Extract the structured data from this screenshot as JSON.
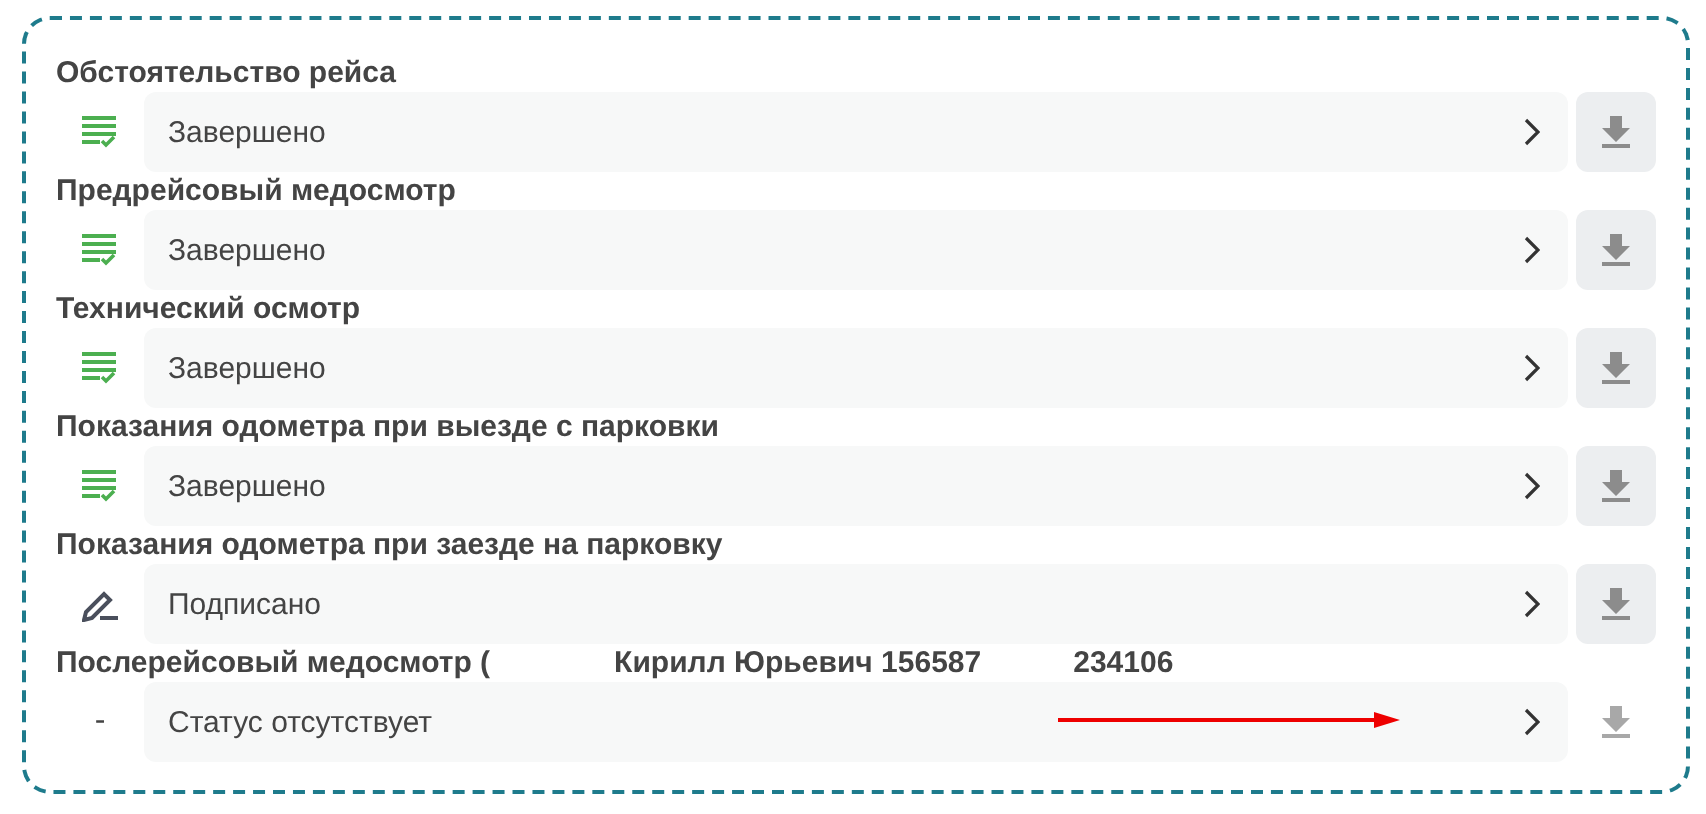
{
  "rows": [
    {
      "title_parts": [
        "Обстоятельство рейса"
      ],
      "kind": "done",
      "status": "Завершено",
      "download_enabled": true
    },
    {
      "title_parts": [
        "Предрейсовый медосмотр"
      ],
      "kind": "done",
      "status": "Завершено",
      "download_enabled": true
    },
    {
      "title_parts": [
        "Технический осмотр"
      ],
      "kind": "done",
      "status": "Завершено",
      "download_enabled": true
    },
    {
      "title_parts": [
        "Показания одометра при выезде с парковки"
      ],
      "kind": "done",
      "status": "Завершено",
      "download_enabled": true
    },
    {
      "title_parts": [
        "Показания одометра при заезде на парковку"
      ],
      "kind": "signed",
      "status": "Подписано",
      "download_enabled": true
    },
    {
      "title_parts": [
        "Послерейсовый медосмотр (",
        "Кирилл Юрьевич 156587",
        "234106"
      ],
      "kind": "none",
      "icon_text": "-",
      "status": "Статус отсутствует",
      "download_enabled": false,
      "annotation_arrow": true
    }
  ]
}
